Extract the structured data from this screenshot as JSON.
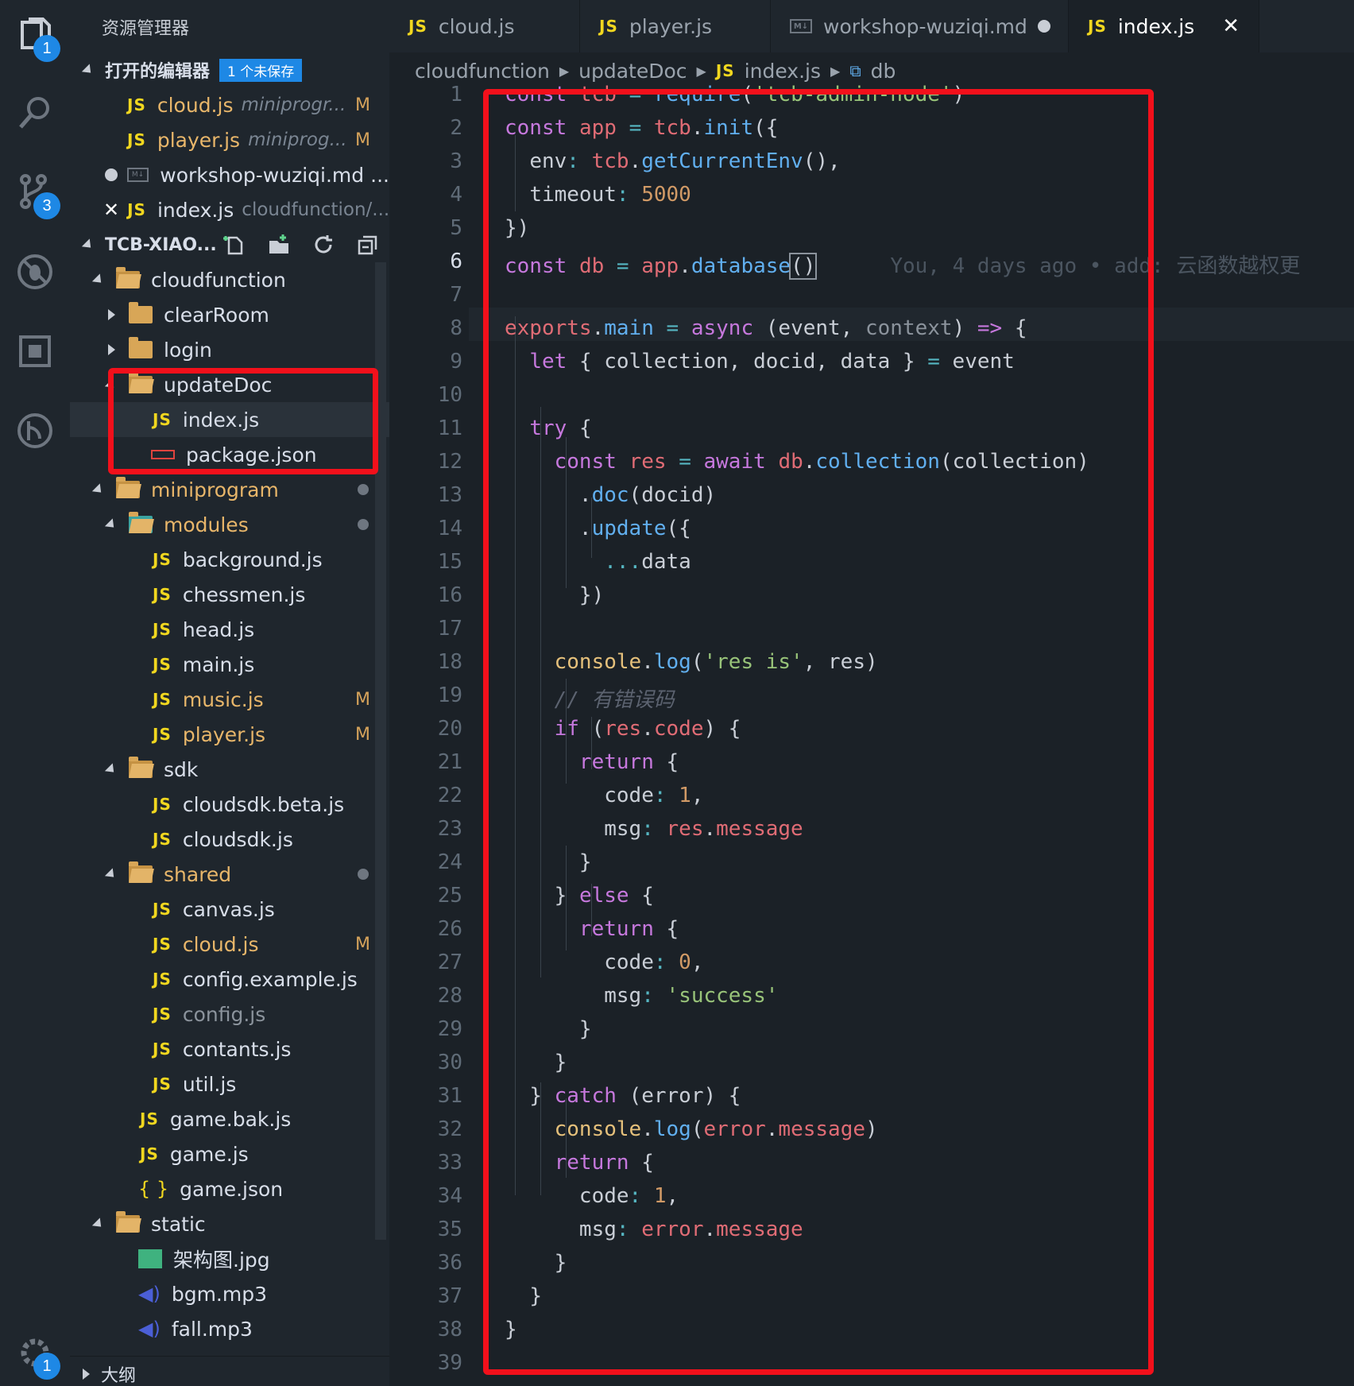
{
  "activity_bar": {
    "explorer_badge": "1",
    "scm_badge": "3",
    "settings_badge": "1"
  },
  "sidebar": {
    "title": "资源管理器",
    "open_editors_label": "打开的编辑器",
    "unsaved_badge": "1 个未保存",
    "open_editors": [
      {
        "name": "cloud.js",
        "path": "miniprogr...",
        "flag": "M"
      },
      {
        "name": "player.js",
        "path": "miniprog...",
        "flag": "M"
      },
      {
        "name": "workshop-wuziqi.md",
        "path": "..."
      },
      {
        "name": "index.js",
        "path": "cloudfunction/..."
      }
    ],
    "project_label": "TCB-XIAO...",
    "tree": {
      "cloudfunction": "cloudfunction",
      "clearRoom": "clearRoom",
      "login": "login",
      "updateDoc": "updateDoc",
      "index_js": "index.js",
      "package_json": "package.json",
      "miniprogram": "miniprogram",
      "modules": "modules",
      "background": "background.js",
      "chessmen": "chessmen.js",
      "head": "head.js",
      "main": "main.js",
      "music": "music.js",
      "player": "player.js",
      "sdk": "sdk",
      "cloudsdk_beta": "cloudsdk.beta.js",
      "cloudsdk": "cloudsdk.js",
      "shared": "shared",
      "canvas": "canvas.js",
      "cloud": "cloud.js",
      "config_example": "config.example.js",
      "config": "config.js",
      "contants": "contants.js",
      "util": "util.js",
      "game_bak": "game.bak.js",
      "game_js": "game.js",
      "game_json": "game.json",
      "static": "static",
      "arch_jpg": "架构图.jpg",
      "bgm": "bgm.mp3",
      "fall": "fall.mp3"
    },
    "m_flag": "M",
    "outline_label": "大纲"
  },
  "tabs": [
    {
      "label": "cloud.js"
    },
    {
      "label": "player.js"
    },
    {
      "label": "workshop-wuziqi.md"
    },
    {
      "label": "index.js"
    }
  ],
  "breadcrumb": [
    "cloudfunction",
    "updateDoc",
    "index.js",
    "db"
  ],
  "editor": {
    "blame": "You, 4 days ago • add: 云函数越权更",
    "comment_line": "// 有错误码",
    "line_numbers": [
      "1",
      "2",
      "3",
      "4",
      "5",
      "6",
      "7",
      "8",
      "9",
      "10",
      "11",
      "12",
      "13",
      "14",
      "15",
      "16",
      "17",
      "18",
      "19",
      "20",
      "21",
      "22",
      "23",
      "24",
      "25",
      "26",
      "27",
      "28",
      "29",
      "30",
      "31",
      "32",
      "33",
      "34",
      "35",
      "36",
      "37",
      "38",
      "39"
    ]
  },
  "colors": {
    "highlight_box": "#f2101b",
    "badge_blue": "#1e88e5",
    "js_icon": "#f1d71f"
  }
}
